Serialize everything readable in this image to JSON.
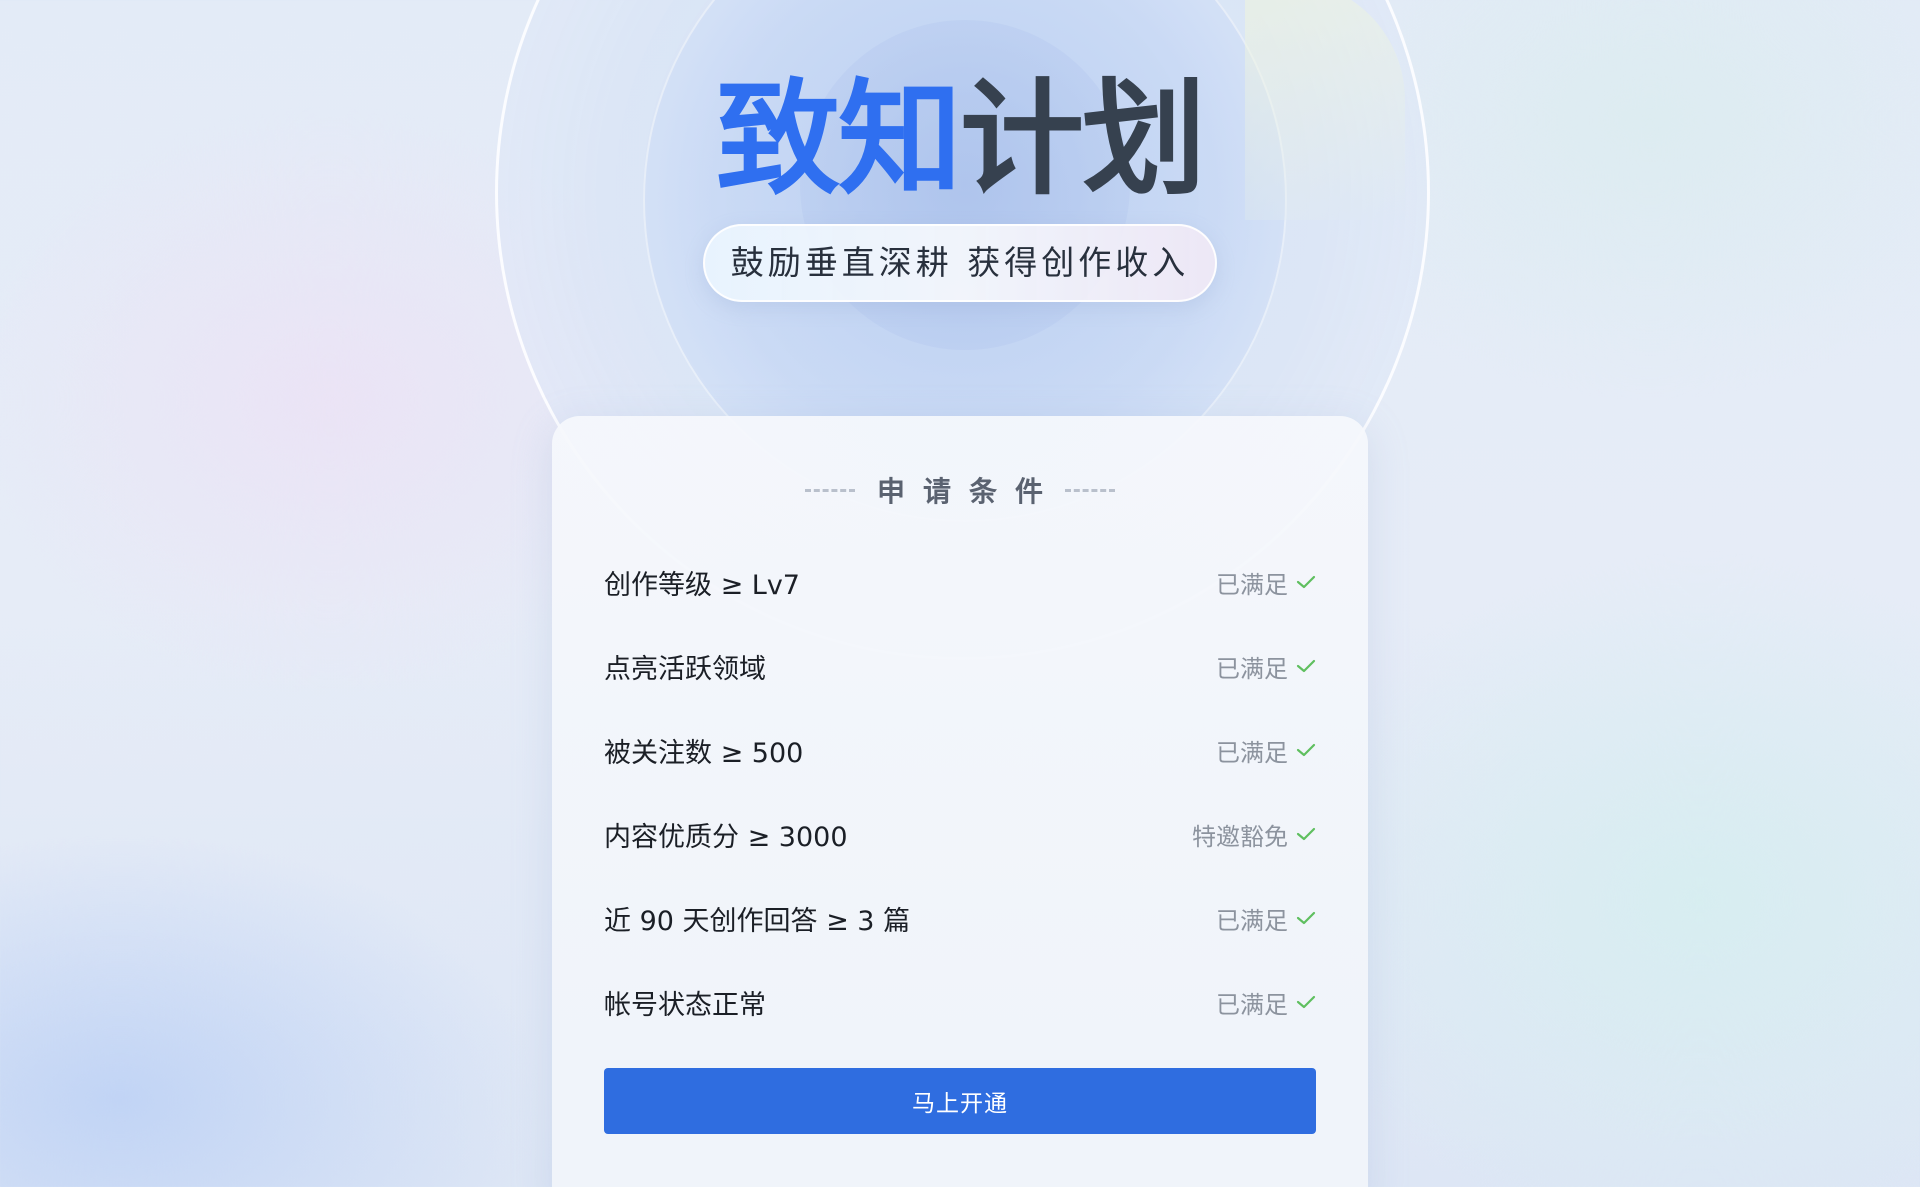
{
  "hero": {
    "title_part1": "致知",
    "title_part2": "计划",
    "subtitle": "鼓励垂直深耕 获得创作收入"
  },
  "colors": {
    "brand_blue": "#2f6ff0",
    "button_blue": "#2f6de0",
    "check_green": "#5fbf5f"
  },
  "card": {
    "section_title": "申请条件",
    "conditions": [
      {
        "label": "创作等级 ≥ Lv7",
        "status": "已满足"
      },
      {
        "label": "点亮活跃领域",
        "status": "已满足"
      },
      {
        "label": "被关注数 ≥ 500",
        "status": "已满足"
      },
      {
        "label": "内容优质分 ≥ 3000",
        "status": "特邀豁免"
      },
      {
        "label": "近 90 天创作回答 ≥ 3 篇",
        "status": "已满足"
      },
      {
        "label": "帐号状态正常",
        "status": "已满足"
      }
    ],
    "cta_label": "马上开通"
  }
}
